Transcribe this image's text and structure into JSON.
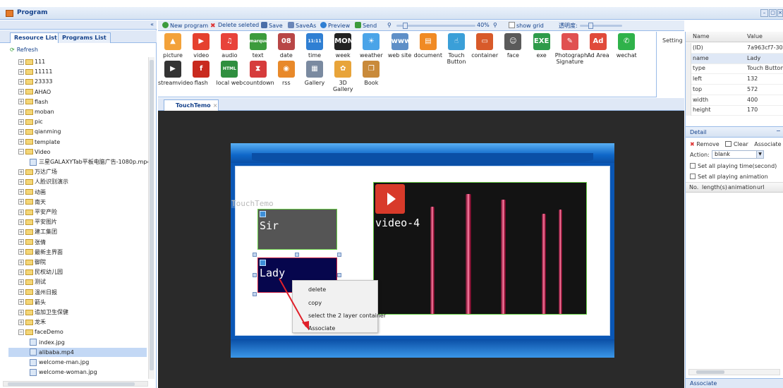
{
  "window": {
    "title": "Program",
    "min": "–",
    "max": "▢",
    "close": "×"
  },
  "left": {
    "collapse": "«",
    "tabs": [
      "Resource List",
      "Programs List"
    ],
    "refresh": "Refresh",
    "tree": [
      {
        "label": "111",
        "type": "folder",
        "depth": 1
      },
      {
        "label": "11111",
        "type": "folder",
        "depth": 1
      },
      {
        "label": "23333",
        "type": "folder",
        "depth": 1
      },
      {
        "label": "AHAO",
        "type": "folder",
        "depth": 1
      },
      {
        "label": "flash",
        "type": "folder",
        "depth": 1
      },
      {
        "label": "moban",
        "type": "folder",
        "depth": 1
      },
      {
        "label": "pic",
        "type": "folder",
        "depth": 1
      },
      {
        "label": "qianming",
        "type": "folder",
        "depth": 1
      },
      {
        "label": "template",
        "type": "folder",
        "depth": 1
      },
      {
        "label": "Video",
        "type": "folder-open",
        "depth": 1
      },
      {
        "label": "三星GALAXYTab平板电脑广告-1080p.mp4",
        "type": "file",
        "depth": 2
      },
      {
        "label": "万达广场",
        "type": "folder",
        "depth": 1
      },
      {
        "label": "人脸识别演示",
        "type": "folder",
        "depth": 1
      },
      {
        "label": "动画",
        "type": "folder",
        "depth": 1
      },
      {
        "label": "南天",
        "type": "folder",
        "depth": 1
      },
      {
        "label": "平安产险",
        "type": "folder",
        "depth": 1
      },
      {
        "label": "平安图片",
        "type": "folder",
        "depth": 1
      },
      {
        "label": "建工集团",
        "type": "folder",
        "depth": 1
      },
      {
        "label": "张倩",
        "type": "folder",
        "depth": 1
      },
      {
        "label": "最新主界面",
        "type": "folder",
        "depth": 1
      },
      {
        "label": "御院",
        "type": "folder",
        "depth": 1
      },
      {
        "label": "民权幼儿园",
        "type": "folder",
        "depth": 1
      },
      {
        "label": "测试",
        "type": "folder",
        "depth": 1
      },
      {
        "label": "温州日报",
        "type": "folder",
        "depth": 1
      },
      {
        "label": "箭头",
        "type": "folder",
        "depth": 1
      },
      {
        "label": "追加卫生保健",
        "type": "folder",
        "depth": 1
      },
      {
        "label": "龙禾",
        "type": "folder",
        "depth": 1
      },
      {
        "label": "faceDemo",
        "type": "folder-open",
        "depth": 1
      },
      {
        "label": "index.jpg",
        "type": "file",
        "depth": 2
      },
      {
        "label": "alibaba.mp4",
        "type": "file",
        "depth": 2,
        "selected": true
      },
      {
        "label": "welcome-man.jpg",
        "type": "file",
        "depth": 2
      },
      {
        "label": "welcome-woman.jpg",
        "type": "file",
        "depth": 2
      }
    ]
  },
  "toolbar": {
    "new_program": "New program",
    "delete_selected": "Delete seleted",
    "save": "Save",
    "saveas": "SaveAs",
    "preview": "Preview",
    "send": "Send",
    "zoom": "40%",
    "zoom_level": 0.4,
    "show_grid": "show grid",
    "opacity_label": "透明度:"
  },
  "palette": [
    {
      "label": "picture",
      "color": "#f3a23a",
      "glyph": "▲"
    },
    {
      "label": "video",
      "color": "#e5412f",
      "glyph": "▶"
    },
    {
      "label": "audio",
      "color": "#e8433a",
      "glyph": "♫"
    },
    {
      "label": "text",
      "color": "#3c9b3c",
      "glyph": "marquee"
    },
    {
      "label": "date",
      "color": "#b84646",
      "glyph": "08"
    },
    {
      "label": "time",
      "color": "#2f7fd3",
      "glyph": "11:11"
    },
    {
      "label": "week",
      "color": "#222222",
      "glyph": "MON"
    },
    {
      "label": "weather",
      "color": "#4aa4e8",
      "glyph": "☀"
    },
    {
      "label": "web site",
      "color": "#5e8fc7",
      "glyph": "www"
    },
    {
      "label": "document",
      "color": "#f08a24",
      "glyph": "▤"
    },
    {
      "label": "Touch Button",
      "color": "#3a9fd8",
      "glyph": "☝"
    },
    {
      "label": "container",
      "color": "#d85a2a",
      "glyph": "▭"
    },
    {
      "label": "face",
      "color": "#5a5a5a",
      "glyph": "☺"
    },
    {
      "label": "exe",
      "color": "#2e9b4a",
      "glyph": "EXE"
    },
    {
      "label": "Photograph Signature",
      "color": "#e05050",
      "glyph": "✎"
    },
    {
      "label": "Ad Area",
      "color": "#e04a3a",
      "glyph": "Ad"
    },
    {
      "label": "wechat",
      "color": "#2fb24a",
      "glyph": "✆"
    },
    {
      "label": "streamvideo",
      "color": "#333333",
      "glyph": "▶"
    },
    {
      "label": "flash",
      "color": "#c92a1e",
      "glyph": "f"
    },
    {
      "label": "local web",
      "color": "#2f8f3f",
      "glyph": "HTML"
    },
    {
      "label": "countdown",
      "color": "#d63c3c",
      "glyph": "⧗"
    },
    {
      "label": "rss",
      "color": "#e8892a",
      "glyph": "◉"
    },
    {
      "label": "Gallery",
      "color": "#7a8aa0",
      "glyph": "▦"
    },
    {
      "label": "3D Gallery",
      "color": "#e8a43a",
      "glyph": "✿"
    },
    {
      "label": "Book",
      "color": "#c98a3a",
      "glyph": "❐"
    }
  ],
  "setting": "Setting",
  "doc_tab": {
    "label": "TouchTemo",
    "close": "×"
  },
  "canvas": {
    "container_label": "TouchTemo",
    "button1_label": "Sir",
    "button2_label": "Lady",
    "video_label": "video-4"
  },
  "context_menu": [
    "delete",
    "copy",
    "select the 2 layer container",
    "Associate"
  ],
  "properties": {
    "headers": [
      "Name",
      "Value"
    ],
    "rows": [
      {
        "name": "(ID)",
        "value": "7a963cf7-30..."
      },
      {
        "name": "name",
        "value": "Lady",
        "selected": true
      },
      {
        "name": "type",
        "value": "Touch Button"
      },
      {
        "name": "left",
        "value": "132"
      },
      {
        "name": "top",
        "value": "572"
      },
      {
        "name": "width",
        "value": "400"
      },
      {
        "name": "height",
        "value": "170"
      }
    ]
  },
  "detail": {
    "title": "Detail",
    "remove": "Remove",
    "clear": "Clear",
    "associate": "Associate",
    "action_label": "Action:",
    "action_value": "blank",
    "set_time": "Set all playing time(second)",
    "set_anim": "Set all playing animation",
    "columns": [
      "No.",
      "length(s)",
      "animation",
      "url"
    ]
  },
  "associate_bar": "Associate",
  "colors": {
    "header_blue": "#15428b",
    "panel_bg": "#dfe8f6",
    "border": "#99bbe8",
    "selected_row": "#c3d8f5",
    "canvas_bg": "#2a2a2a",
    "stage_blue": "#0a57b6",
    "touch_button_selected": "#06064d",
    "touch_button_normal": "#555555",
    "video_border": "#66cc44"
  }
}
